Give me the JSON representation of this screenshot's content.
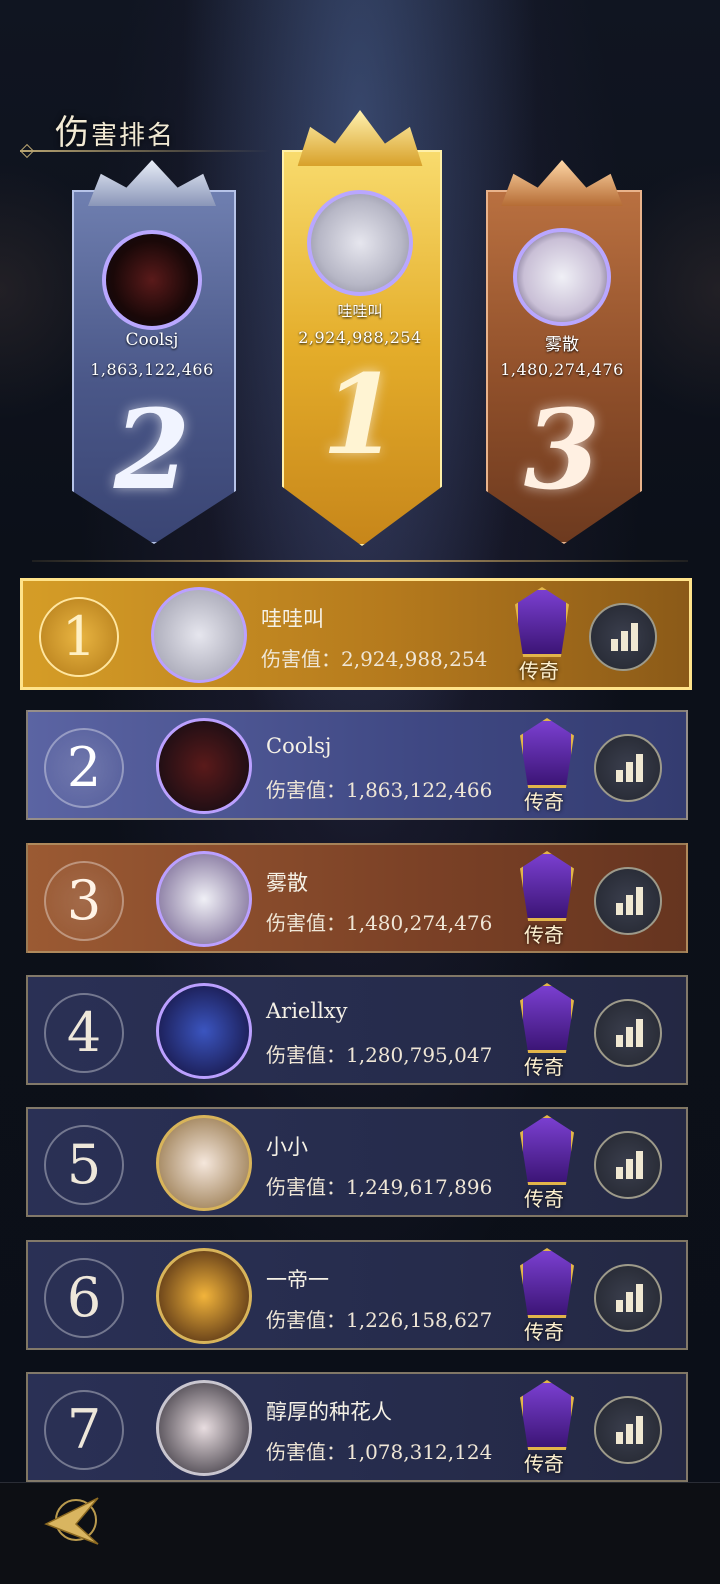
{
  "page": {
    "title_first": "伤",
    "title_rest": "害排名"
  },
  "podium": [
    {
      "rank": "2",
      "name": "Coolsj",
      "score": "1,863,122,466"
    },
    {
      "rank": "1",
      "name": "哇哇叫",
      "score": "2,924,988,254"
    },
    {
      "rank": "3",
      "name": "雾散",
      "score": "1,480,274,476"
    }
  ],
  "rows": [
    {
      "rank": "1",
      "name": "哇哇叫",
      "damage": "伤害值：2,924,988,254",
      "badge": "传奇"
    },
    {
      "rank": "2",
      "name": "Coolsj",
      "damage": "伤害值：1,863,122,466",
      "badge": "传奇"
    },
    {
      "rank": "3",
      "name": "雾散",
      "damage": "伤害值：1,480,274,476",
      "badge": "传奇"
    },
    {
      "rank": "4",
      "name": "Ariellxy",
      "damage": "伤害值：1,280,795,047",
      "badge": "传奇"
    },
    {
      "rank": "5",
      "name": "小小",
      "damage": "伤害值：1,249,617,896",
      "badge": "传奇"
    },
    {
      "rank": "6",
      "name": "一帝一",
      "damage": "伤害值：1,226,158,627",
      "badge": "传奇"
    },
    {
      "rank": "7",
      "name": "醇厚的种花人",
      "damage": "伤害值：1,078,312,124",
      "badge": "传奇"
    }
  ],
  "icons": {
    "stats": "bar-chart-icon",
    "badge": "legend-emblem-icon",
    "back": "back-arrow-icon"
  },
  "colors": {
    "gold": "#d59d27",
    "silver": "#4a5788",
    "bronze": "#8f4f2a",
    "plain": "#262c4c"
  }
}
